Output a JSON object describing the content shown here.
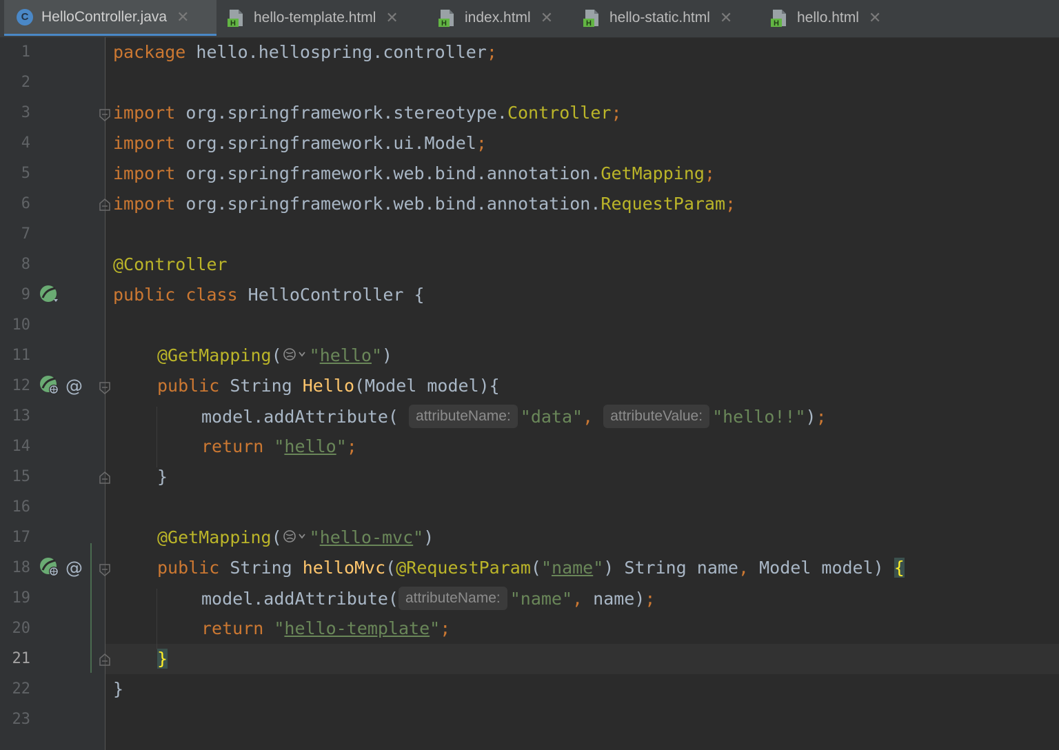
{
  "tabs": [
    {
      "label": "HelloController.java",
      "icon": "java-class-icon",
      "active": true,
      "icon_letter": "C"
    },
    {
      "label": "hello-template.html",
      "icon": "html-file-icon",
      "active": false
    },
    {
      "label": "index.html",
      "icon": "html-file-icon",
      "active": false
    },
    {
      "label": "hello-static.html",
      "icon": "html-file-icon",
      "active": false
    },
    {
      "label": "hello.html",
      "icon": "html-file-icon",
      "active": false
    }
  ],
  "tab_close_glyph": "✕",
  "html_icon_letter": "H",
  "editor": {
    "current_line": 21,
    "line_numbers": [
      "1",
      "2",
      "3",
      "4",
      "5",
      "6",
      "7",
      "8",
      "9",
      "10",
      "11",
      "12",
      "13",
      "14",
      "15",
      "16",
      "17",
      "18",
      "19",
      "20",
      "21",
      "22",
      "23"
    ],
    "code": {
      "l1": {
        "kw": "package",
        "rest": " hello.hellospring.controller",
        "semi": ";"
      },
      "l3": {
        "kw": "import",
        "rest": " org.springframework.stereotype.",
        "cls": "Controller",
        "semi": ";"
      },
      "l4": {
        "kw": "import",
        "rest": " org.springframework.ui.Model",
        "semi": ";"
      },
      "l5": {
        "kw": "import",
        "rest": " org.springframework.web.bind.annotation.",
        "cls": "GetMapping",
        "semi": ";"
      },
      "l6": {
        "kw": "import",
        "rest": " org.springframework.web.bind.annotation.",
        "cls": "RequestParam",
        "semi": ";"
      },
      "l8": {
        "annotation": "@Controller"
      },
      "l9": {
        "kw": "public class",
        "rest": " HelloController {"
      },
      "l11": {
        "annotation": "@GetMapping",
        "open": "(",
        "q1": "\"",
        "value": "hello",
        "q2": "\"",
        "close": ")"
      },
      "l12": {
        "kw": "public",
        "type": " String ",
        "fn": "Hello",
        "rest": "(Model model){"
      },
      "l13": {
        "call": "model.addAttribute(",
        "hint1": "attributeName:",
        "arg1": "\"data\"",
        "comma": ", ",
        "hint2": "attributeValue:",
        "arg2": "\"hello!!\"",
        "close": ")",
        "semi": ";"
      },
      "l14": {
        "kw": "return",
        "q1": " \"",
        "value": "hello",
        "q2": "\"",
        "semi": ";"
      },
      "l15": {
        "brace": "}"
      },
      "l17": {
        "annotation": "@GetMapping",
        "open": "(",
        "q1": "\"",
        "value": "hello-mvc",
        "q2": "\"",
        "close": ")"
      },
      "l18": {
        "kw": "public",
        "type": " String ",
        "fn": "helloMvc",
        "open": "(",
        "annotation": "@RequestParam",
        "p1": "(",
        "q1": "\"",
        "value": "name",
        "q2": "\"",
        "p2": ")",
        "rest1": " String name",
        "comma": ",",
        "rest2": " Model model) ",
        "brace": "{"
      },
      "l19": {
        "call": "model.addAttribute(",
        "hint1": "attributeName:",
        "arg1": "\"name\"",
        "comma": ",",
        "rest": " name)",
        "semi": ";"
      },
      "l20": {
        "kw": "return",
        "q1": " \"",
        "value": "hello-template",
        "q2": "\"",
        "semi": ";"
      },
      "l21": {
        "brace": "}"
      },
      "l22": {
        "brace": "}"
      }
    }
  },
  "gutter_at_glyph": "@",
  "colors": {
    "keyword": "#cc7832",
    "annotation": "#bbb529",
    "string": "#6a8759",
    "method": "#ffc66d",
    "text": "#a9b7c6",
    "background": "#2b2b2b",
    "gutter": "#313335",
    "spring_green": "#6aab73"
  }
}
